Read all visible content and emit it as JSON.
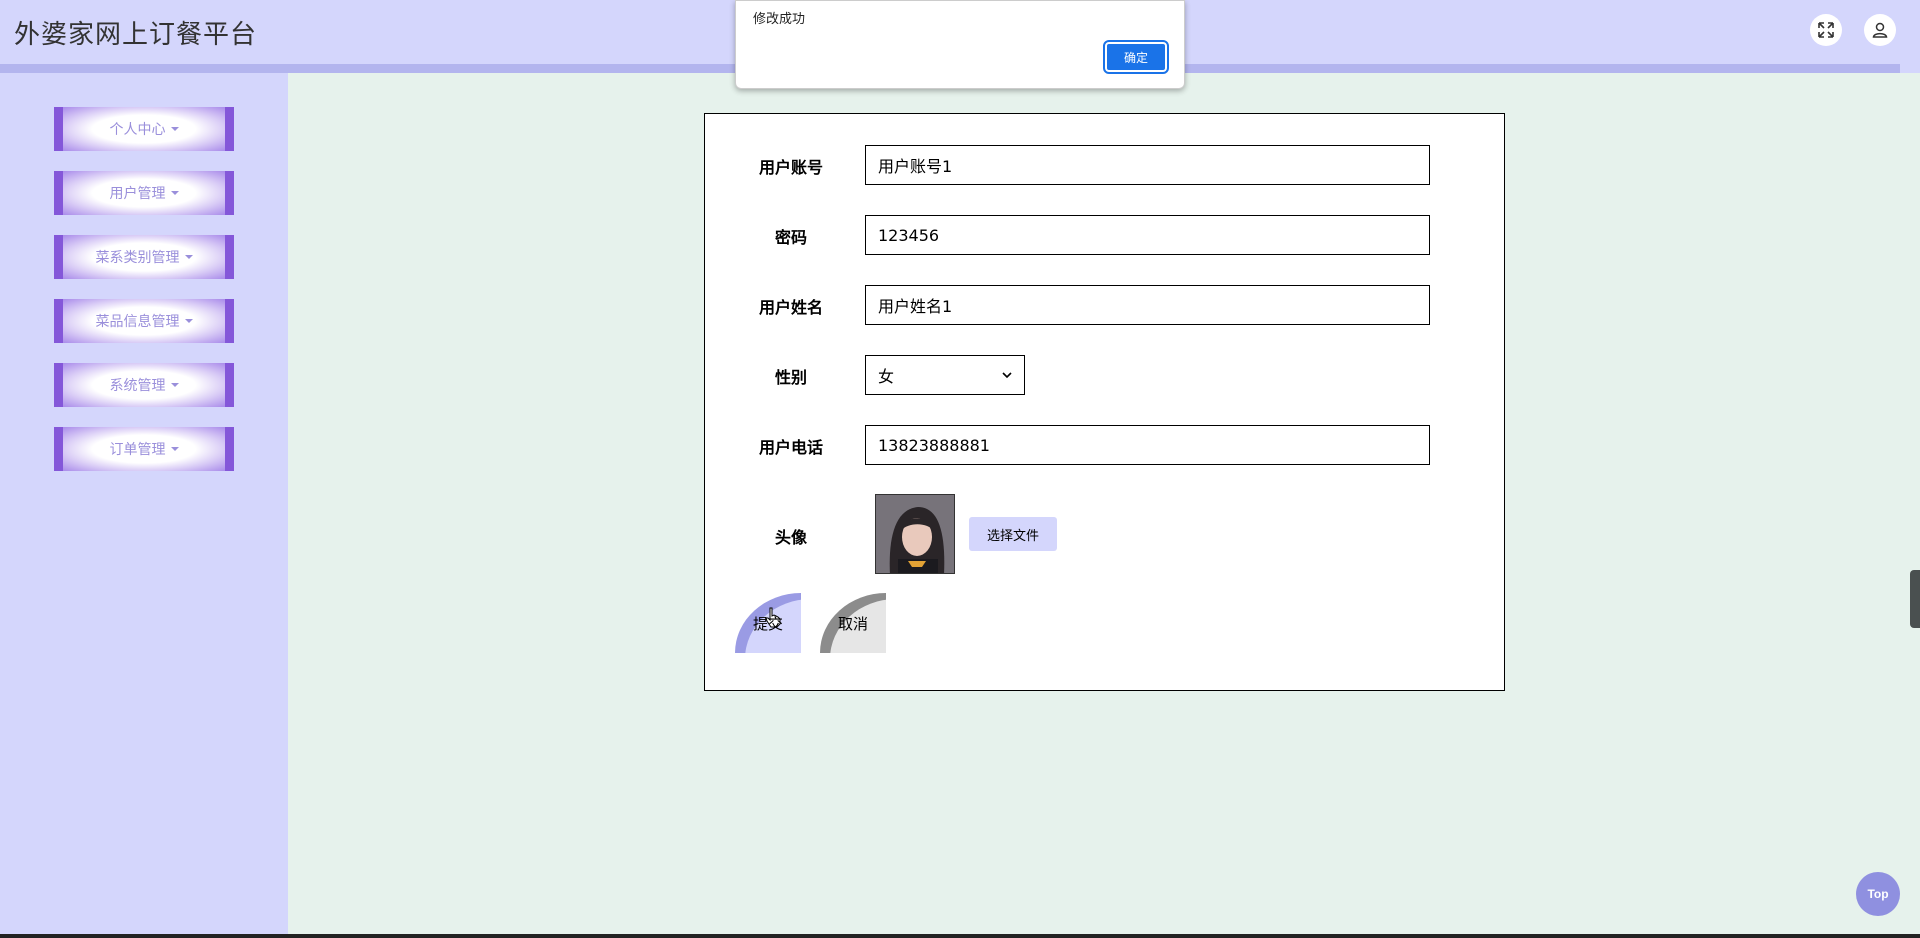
{
  "app": {
    "title": "外婆家网上订餐平台"
  },
  "header": {
    "fullscreen_icon": "expand-arrows-icon",
    "user_icon": "user-icon"
  },
  "sidebar": {
    "items": [
      {
        "label": "个人中心"
      },
      {
        "label": "用户管理"
      },
      {
        "label": "菜系类别管理"
      },
      {
        "label": "菜品信息管理"
      },
      {
        "label": "系统管理"
      },
      {
        "label": "订单管理"
      }
    ]
  },
  "form": {
    "account": {
      "label": "用户账号",
      "value": "用户账号1"
    },
    "password": {
      "label": "密码",
      "value": "123456"
    },
    "name": {
      "label": "用户姓名",
      "value": "用户姓名1"
    },
    "gender": {
      "label": "性别",
      "value": "女"
    },
    "phone": {
      "label": "用户电话",
      "value": "13823888881"
    },
    "avatar": {
      "label": "头像",
      "choose_file": "选择文件"
    },
    "submit_label": "提交",
    "cancel_label": "取消"
  },
  "dialog": {
    "message": "修改成功",
    "ok_label": "确定"
  },
  "top_button": {
    "label": "Top"
  },
  "colors": {
    "header_bg": "#d4d6fc",
    "content_bg": "#e6f2ec",
    "menu_accent": "#8457d9",
    "dialog_ok": "#1a73e8",
    "top_btn": "#8f90e0"
  }
}
